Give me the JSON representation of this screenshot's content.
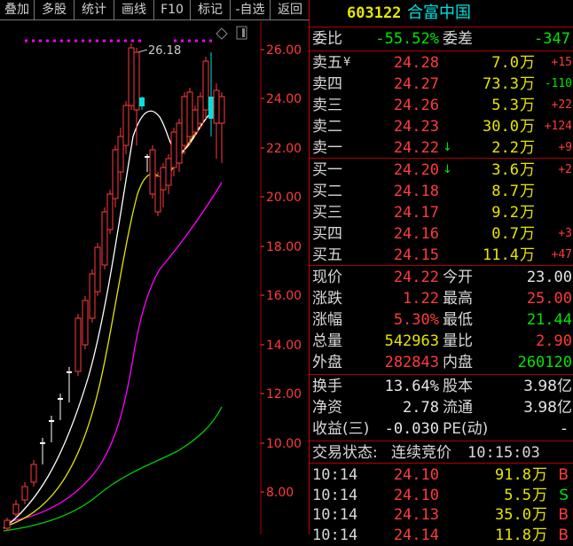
{
  "toolbar": {
    "buttons": [
      "叠加",
      "多股",
      "统计",
      "画线",
      "F10",
      "标记",
      "-自选",
      "返回"
    ]
  },
  "stock": {
    "code": "603122",
    "name": "合富中国"
  },
  "chart": {
    "price_max_label": "26.18",
    "y_ticks": [
      "26.00",
      "24.00",
      "22.00",
      "20.00",
      "18.00",
      "16.00",
      "14.00",
      "12.00",
      "10.00",
      "8.00"
    ]
  },
  "order_book": {
    "weibi_label": "委比",
    "weibi_value": "-55.52%",
    "weicha_label": "委差",
    "weicha_value": "-347",
    "sell": [
      {
        "label": "卖五",
        "mark": "¥",
        "price": "24.28",
        "vol": "7.0",
        "unit": "万",
        "chg": "+15"
      },
      {
        "label": "卖四",
        "mark": "",
        "price": "24.27",
        "vol": "73.3",
        "unit": "万",
        "chg": "-110"
      },
      {
        "label": "卖三",
        "mark": "",
        "price": "24.26",
        "vol": "5.3",
        "unit": "万",
        "chg": "+22"
      },
      {
        "label": "卖二",
        "mark": "",
        "price": "24.23",
        "vol": "30.0",
        "unit": "万",
        "chg": "+124"
      },
      {
        "label": "卖一",
        "mark": "↓",
        "price": "24.22",
        "vol": "2.2",
        "unit": "万",
        "chg": "+9"
      }
    ],
    "buy": [
      {
        "label": "买一",
        "mark": "↓",
        "price": "24.20",
        "vol": "3.6",
        "unit": "万",
        "chg": "+2"
      },
      {
        "label": "买二",
        "mark": "",
        "price": "24.18",
        "vol": "8.7",
        "unit": "万",
        "chg": ""
      },
      {
        "label": "买三",
        "mark": "",
        "price": "24.17",
        "vol": "9.2",
        "unit": "万",
        "chg": ""
      },
      {
        "label": "买四",
        "mark": "",
        "price": "24.16",
        "vol": "0.7",
        "unit": "万",
        "chg": "+3"
      },
      {
        "label": "买五",
        "mark": "",
        "price": "24.15",
        "vol": "11.4",
        "unit": "万",
        "chg": "+47"
      }
    ]
  },
  "quote": {
    "xianjia_label": "现价",
    "xianjia": "24.22",
    "jinkai_label": "今开",
    "jinkai": "23.00",
    "zhangdie_label": "涨跌",
    "zhangdie": "1.22",
    "zuigao_label": "最高",
    "zuigao": "25.00",
    "zhangfu_label": "涨幅",
    "zhangfu": "5.30%",
    "zuidi_label": "最低",
    "zuidi": "21.44",
    "zongliang_label": "总量",
    "zongliang": "542963",
    "liangbi_label": "量比",
    "liangbi": "2.90",
    "waipan_label": "外盘",
    "waipan": "282843",
    "neipan_label": "内盘",
    "neipan": "260120"
  },
  "fundamentals": {
    "huanshou_label": "换手",
    "huanshou": "13.64%",
    "guben_label": "股本",
    "guben": "3.98亿",
    "jingzi_label": "净资",
    "jingzi": "2.78",
    "liutong_label": "流通",
    "liutong": "3.98亿",
    "shouyi_label": "收益(三)",
    "shouyi": "-0.030",
    "pe_label": "PE(动)",
    "pe": "-"
  },
  "trade_status": {
    "label": "交易状态:",
    "state": "连续竞价",
    "time": "10:15:03"
  },
  "ticks": [
    {
      "time": "10:14",
      "price": "24.10",
      "vol": "91.8",
      "unit": "万",
      "side": "B"
    },
    {
      "time": "10:14",
      "price": "24.10",
      "vol": "5.5",
      "unit": "万",
      "side": "S"
    },
    {
      "time": "10:14",
      "price": "24.13",
      "vol": "35.0",
      "unit": "万",
      "side": "B"
    },
    {
      "time": "10:14",
      "price": "24.14",
      "vol": "11.8",
      "unit": "万",
      "side": "B"
    }
  ],
  "colors": {
    "up": "#ff3b3b",
    "down": "#00e600",
    "cyan": "#00e0e0",
    "yellow": "#e6e600"
  }
}
